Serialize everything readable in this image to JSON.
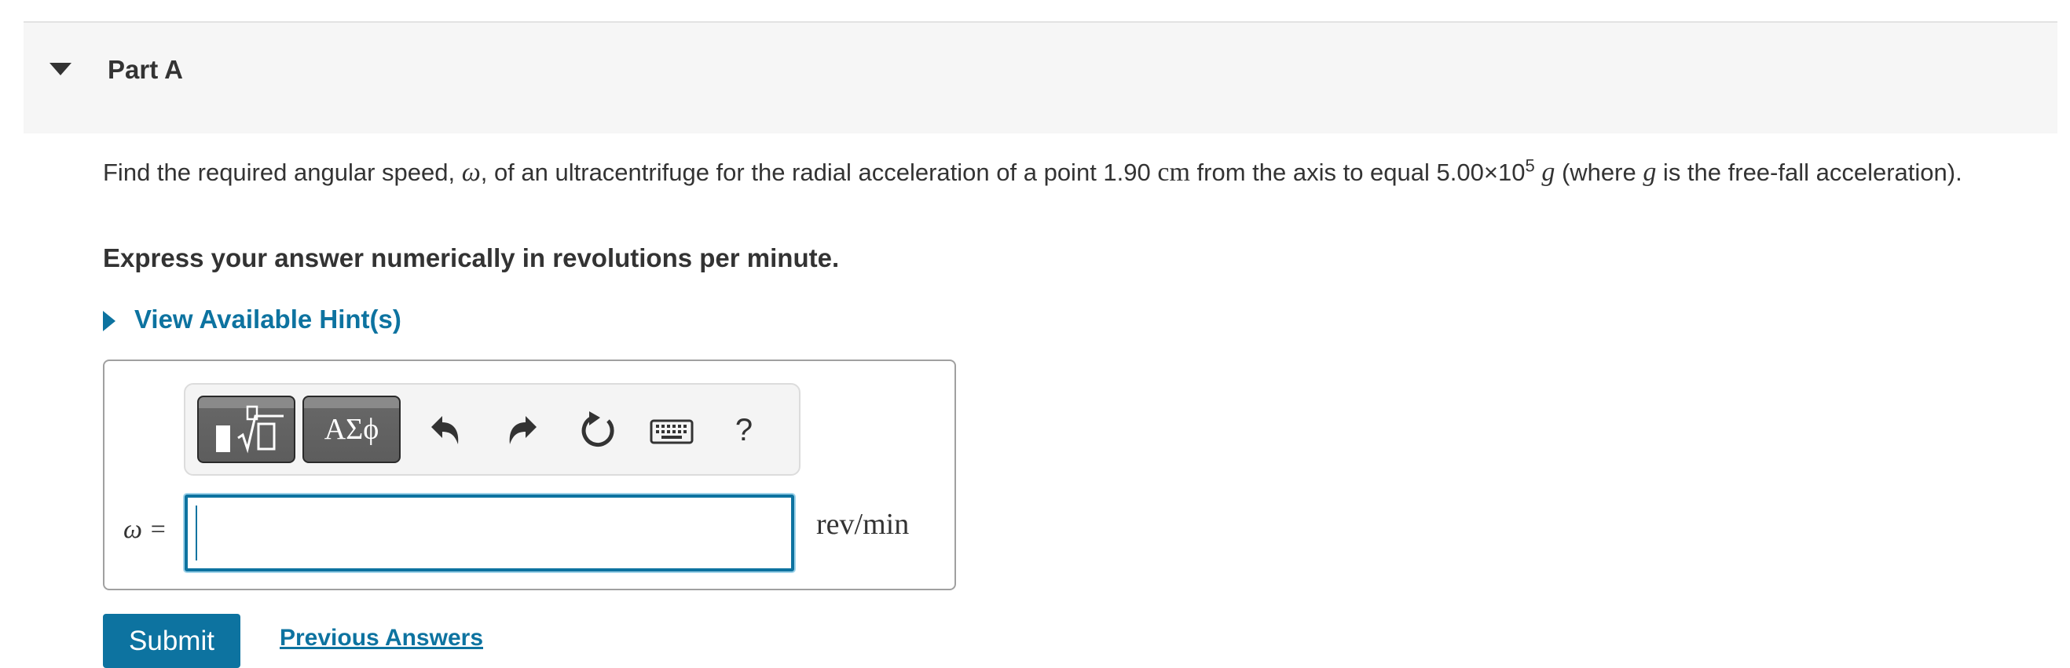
{
  "part": {
    "title": "Part A"
  },
  "question": {
    "text_1": "Find the required angular speed, ",
    "omega": "ω",
    "text_2": ", of an ultracentrifuge for the radial acceleration of a point 1.90 ",
    "unit_cm": "cm",
    "text_3": " from the axis to equal 5.00×10",
    "exponent": "5",
    "g_1": "g",
    "text_4": " (where ",
    "g_2": "g",
    "text_5": " is the free-fall acceleration)."
  },
  "instruction": "Express your answer numerically in revolutions per minute.",
  "hint": {
    "label": "View Available Hint(s)"
  },
  "toolbar": {
    "greek_label": "ΑΣϕ",
    "icons": [
      "templates-icon",
      "undo-icon",
      "redo-icon",
      "reset-icon",
      "keyboard-icon",
      "help-icon"
    ],
    "help_label": "?"
  },
  "answer": {
    "variable_label": "ω =",
    "value": "",
    "units": "rev/min"
  },
  "actions": {
    "submit_label": "Submit",
    "previous_answers_label": "Previous Answers"
  },
  "colors": {
    "accent": "#0d73a0",
    "header_bg": "#f6f6f6",
    "text": "#333333"
  }
}
